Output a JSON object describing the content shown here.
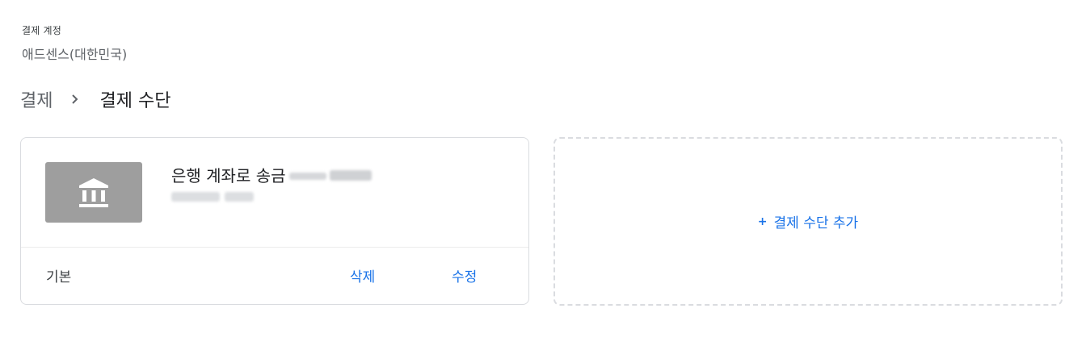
{
  "account": {
    "label": "결제 계정",
    "name": "애드센스(대한민국)"
  },
  "breadcrumb": {
    "parent": "결제",
    "current": "결제 수단",
    "separator_icon": "chevron-right-icon"
  },
  "payment_card": {
    "icon": "bank-icon",
    "tile_color": "#9e9e9e",
    "title": "은행 계좌로 송금",
    "status": "기본",
    "delete_label": "삭제",
    "edit_label": "수정"
  },
  "add_card": {
    "plus": "+",
    "label": "결제 수단 추가"
  },
  "colors": {
    "accent": "#1a73e8",
    "border": "#dadce0",
    "text_primary": "#202124",
    "text_secondary": "#5f6368"
  }
}
